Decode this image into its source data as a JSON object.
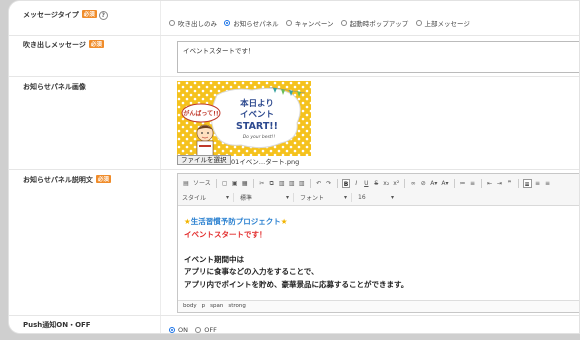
{
  "message_type": {
    "label": "メッセージタイプ",
    "required": "必須",
    "help": "?",
    "options": [
      {
        "label": "吹き出しのみ",
        "selected": false
      },
      {
        "label": "お知らせパネル",
        "selected": true
      },
      {
        "label": "キャンペーン",
        "selected": false
      },
      {
        "label": "起動時ポップアップ",
        "selected": false
      },
      {
        "label": "上部メッセージ",
        "selected": false
      }
    ]
  },
  "balloon_message": {
    "label": "吹き出しメッセージ",
    "required": "必須",
    "value": "イベントスタートです！"
  },
  "panel_image": {
    "label": "お知らせパネル画像",
    "banner_line1": "本日より",
    "banner_line2": "イベント",
    "banner_line3": "START!!",
    "banner_sub": "Do your best!!",
    "bubble_text": "がんばって!!",
    "file_button": "ファイルを選択",
    "file_name": "01イベン…タート.png"
  },
  "panel_description": {
    "label": "お知らせパネル説明文",
    "required": "必須",
    "toolbar": {
      "source": "ソース",
      "style": "スタイル",
      "format": "標準",
      "font": "フォント",
      "size": "16"
    },
    "content": {
      "line1": "生活習慣予防プロジェクト",
      "line2": "イベントスタートです！",
      "line3": "イベント期間中は",
      "line4": "アプリに食事などの入力をすることで、",
      "line5": "アプリ内でポイントを貯め、豪華景品に応募することができます。"
    },
    "path": [
      "body",
      "p",
      "span",
      "strong"
    ],
    "colors": {
      "blue": "#2a80d0",
      "red": "#e22a2a",
      "star": "#f2b400"
    }
  },
  "push": {
    "label": "Push通知ON・OFF",
    "options": [
      {
        "label": "ON",
        "selected": true
      },
      {
        "label": "OFF",
        "selected": false
      }
    ]
  }
}
